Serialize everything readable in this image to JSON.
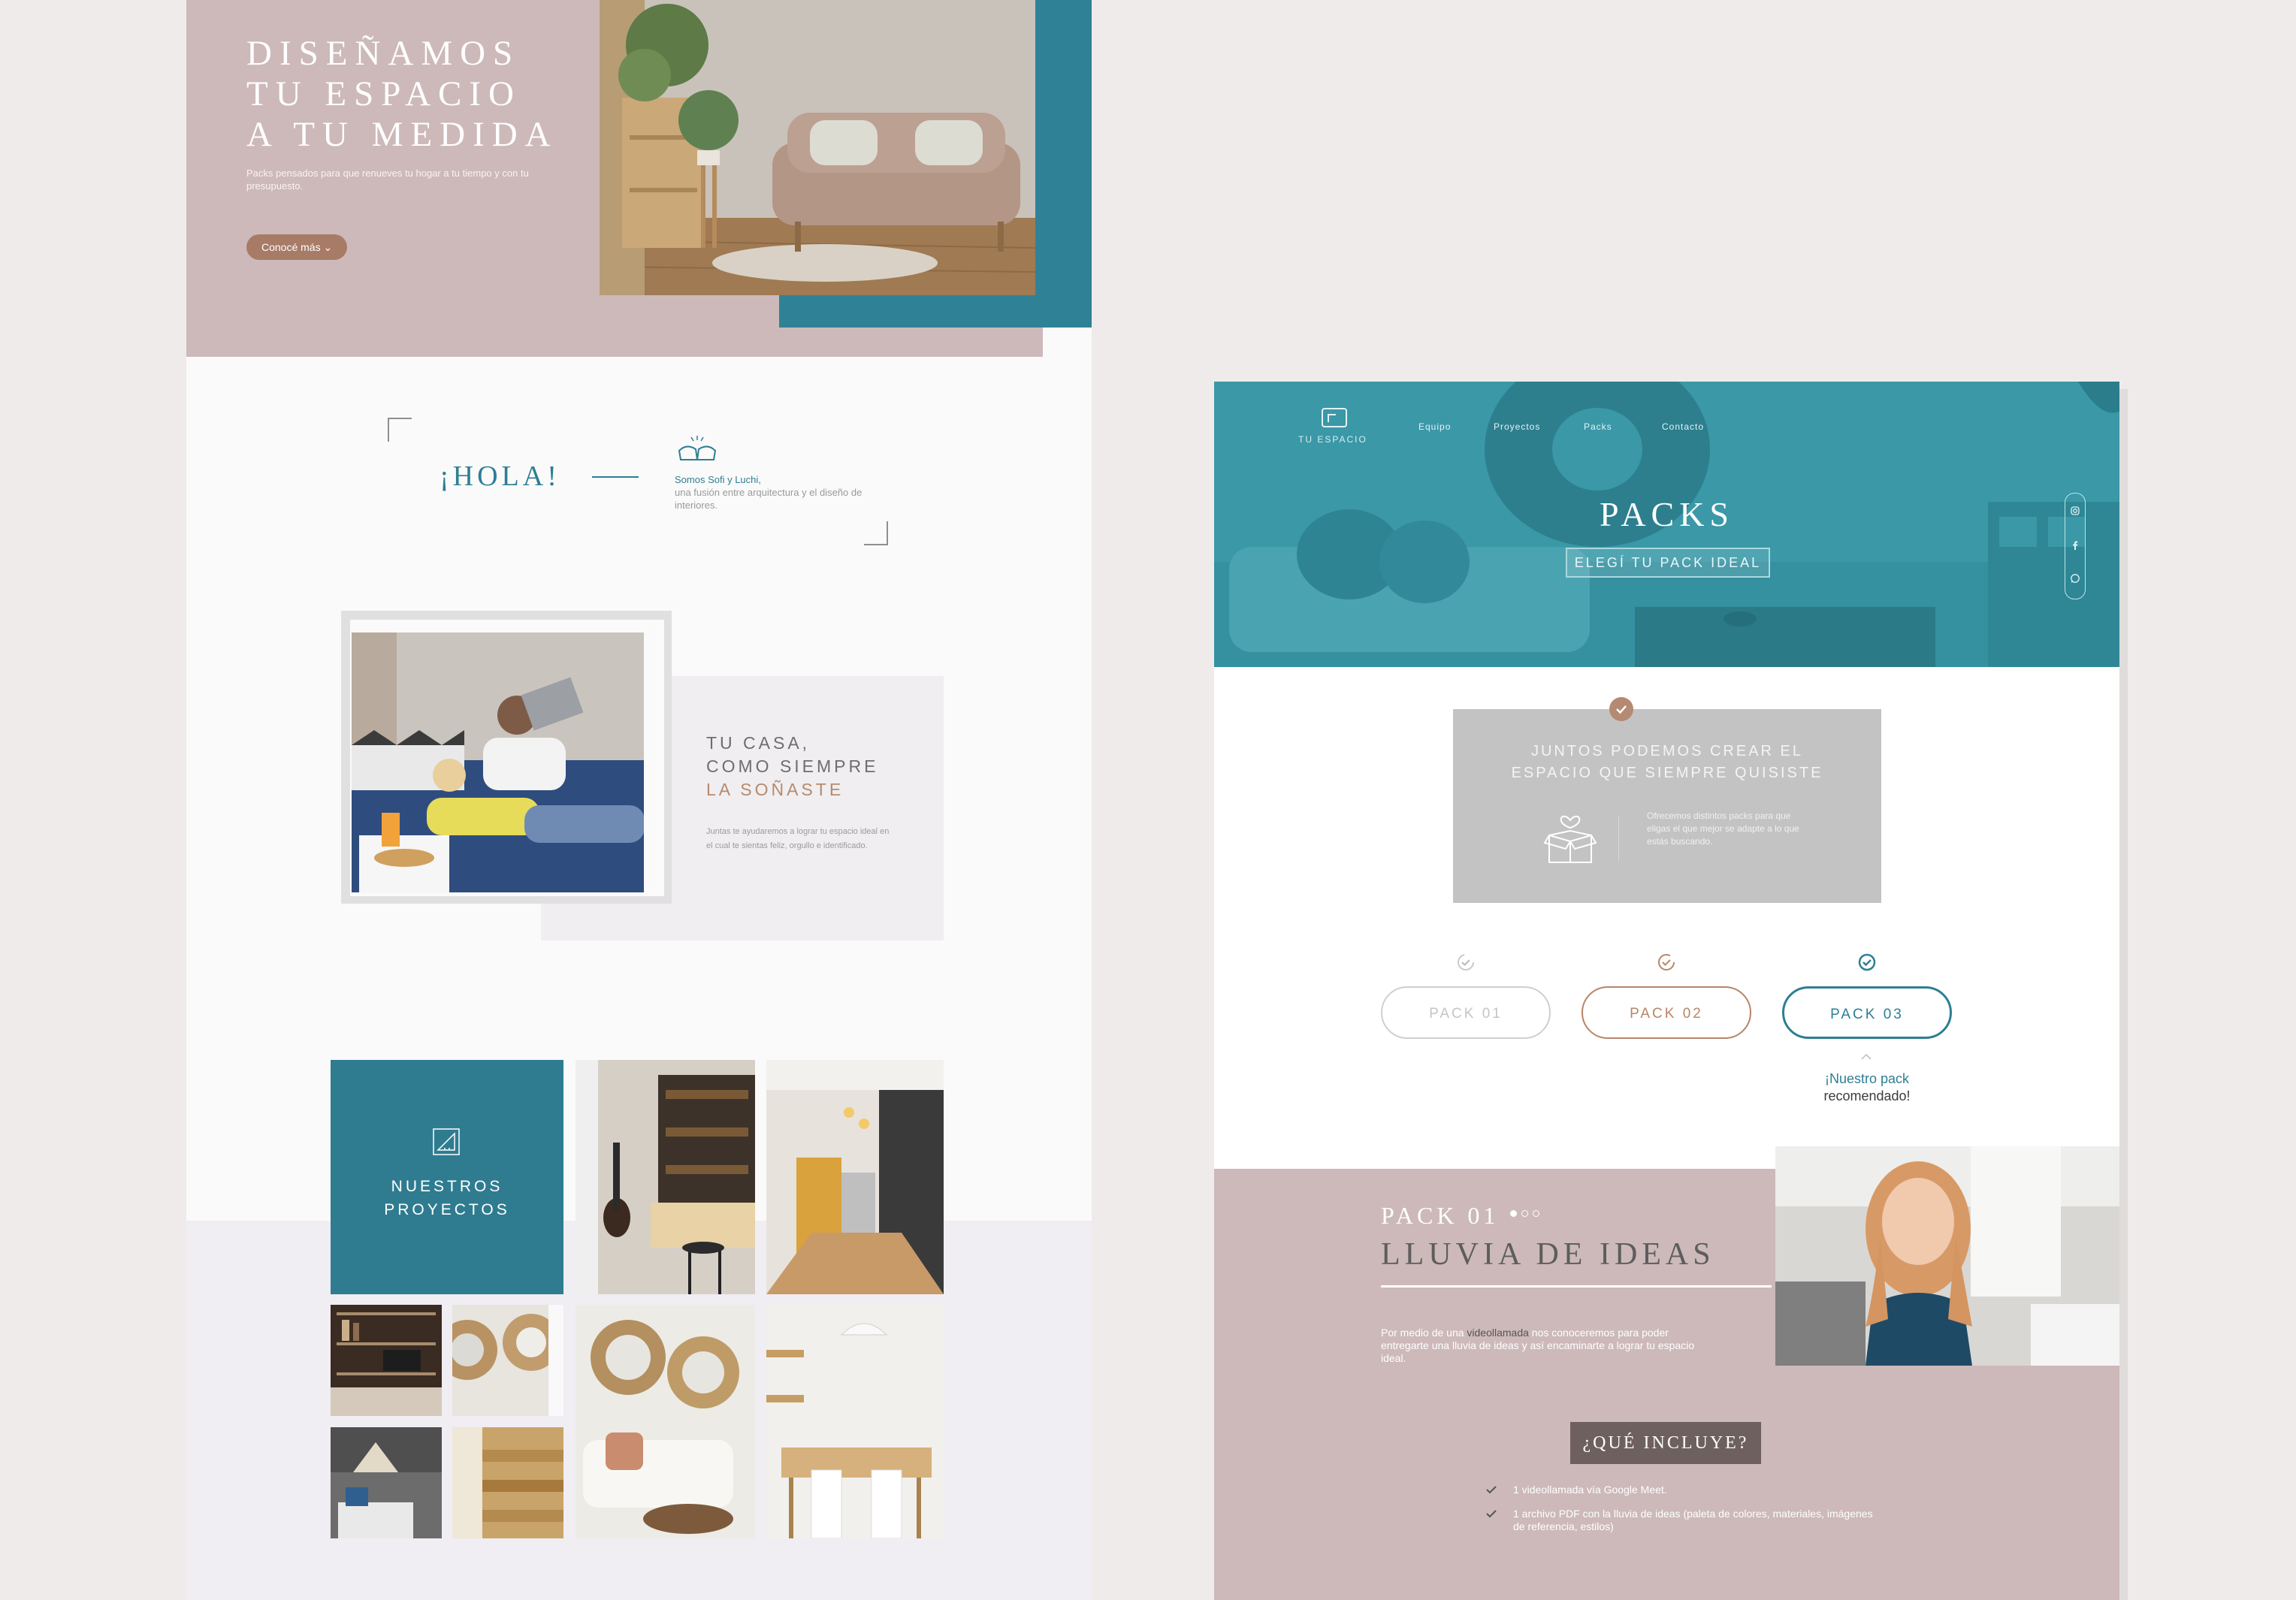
{
  "left": {
    "hero": {
      "title_lines": [
        "DISEÑAMOS",
        "TU ESPACIO",
        "A TU MEDIDA"
      ],
      "subtitle": "Packs pensados para que renueves tu hogar a tu tiempo y con tu presupuesto.",
      "cta": "Conocé más ⌄"
    },
    "hola": {
      "title": "¡HOLA!",
      "lead": "Somos Sofi y Luchi,",
      "text": "una fusión entre arquitectura y el diseño de interiores."
    },
    "casa": {
      "line1": "TU CASA,",
      "line2": "COMO SIEMPRE",
      "line3": "LA SOÑASTE",
      "text": "Juntas te ayudaremos a lograr tu espacio ideal en el cual te sientas feliz, orgullo e identificado."
    },
    "projects": {
      "line1": "NUESTROS",
      "line2": "PROYECTOS"
    }
  },
  "right": {
    "logo_label": "TU ESPACIO",
    "nav": [
      "Equipo",
      "Proyectos",
      "Packs",
      "Contacto"
    ],
    "hero_title": "PACKS",
    "hero_subtitle": "ELEGÍ TU PACK IDEAL",
    "social": [
      "instagram-icon",
      "facebook-icon",
      "whatsapp-icon"
    ],
    "juntos": {
      "line1": "JUNTOS PODEMOS CREAR EL",
      "line2": "ESPACIO QUE SIEMPRE QUISISTE",
      "text": "Ofrecemos distintos packs para que eligas el que mejor se adapte a lo que estás buscando."
    },
    "packs": [
      "PACK 01",
      "PACK 02",
      "PACK 03"
    ],
    "recommended_line1": "¡Nuestro pack",
    "recommended_line2": "recomendado!",
    "detail": {
      "label": "PACK 01",
      "name": "LLUVIA DE IDEAS",
      "desc_pre": "Por medio de una ",
      "desc_highlight": "videollamada",
      "desc_post": " nos conoceremos para poder entregarte una lluvia de ideas y así encaminarte a lograr tu espacio ideal.",
      "button": "¿QUÉ INCLUYE?",
      "includes": [
        "1 videollamada vía Google Meet.",
        "1 archivo PDF con la lluvia de ideas (paleta de colores, materiales, imágenes de referencia, estilos)"
      ],
      "active_dot": 1,
      "dot_count": 3
    }
  },
  "colors": {
    "teal": "#2f7c91",
    "mauve": "#cdb9ba",
    "copper": "#b88568",
    "grey_card": "#c3c3c4"
  }
}
